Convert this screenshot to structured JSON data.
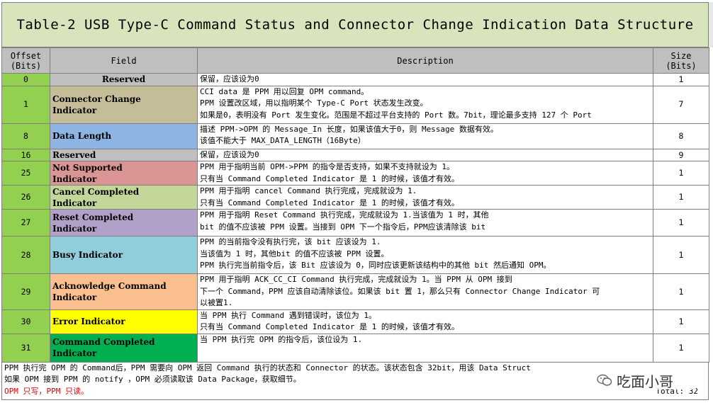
{
  "title": "Table-2 USB Type-C Command Status and Connector Change Indication Data Structure",
  "header": {
    "offset_line1": "Offset",
    "offset_line2": "(Bits)",
    "field": "Field",
    "description": "Description",
    "size_line1": "Size",
    "size_line2": "(Bits)"
  },
  "rows": [
    {
      "offset": "0",
      "field": [
        "Reserved"
      ],
      "desc": [
        "保留，应该设为0"
      ],
      "size": "1",
      "color": "#bfbfbf"
    },
    {
      "offset": "1",
      "field": [
        "Connector Change",
        "Indicator"
      ],
      "desc": [
        "CCI data 是 PPM 用以回复 OPM command。",
        "PPM 设置改区域，用以指明某个 Type-C Port 状态发生改变。",
        "如果是0，表明没有 Port 发生变化。范围是不超过平台支持的 Port 数。7bit，理论最多支持 127 个 Port"
      ],
      "size": "7",
      "color": "#c4bd97"
    },
    {
      "offset": "8",
      "field": [
        "Data Length"
      ],
      "desc": [
        "描述 PPM->OPM 的 Message_In 长度，如果该值大于0，则 Message 数据有效。",
        "该值不能大于 MAX_DATA_LENGTH（16Byte）"
      ],
      "size": "8",
      "color": "#8db4e2"
    },
    {
      "offset": "16",
      "field": [
        "Reserved"
      ],
      "desc": [
        "保留，应该设为0"
      ],
      "size": "9",
      "color": "#bfbfbf"
    },
    {
      "offset": "25",
      "field": [
        "Not Supported",
        "Indicator"
      ],
      "desc": [
        "PPM 用于指明当前 OPM->PPM 的指令是否支持，如果不支持就设为 1。",
        "只有当 Command Completed Indicator 是 1 的时候，该值才有效。"
      ],
      "size": "1",
      "color": "#da9694"
    },
    {
      "offset": "26",
      "field": [
        "Cancel Completed",
        "Indicator"
      ],
      "desc": [
        "PPM 用于指明 cancel Command 执行完成，完成就设为 1.",
        "只有当 Command Completed Indicator 是 1 的时候，该值才有效。"
      ],
      "size": "1",
      "color": "#c4d79b"
    },
    {
      "offset": "27",
      "field": [
        "Reset Completed",
        "Indicator"
      ],
      "desc": [
        "PPM 用于指明 Reset Command 执行完成，完成就设为 1.当该值为 1 时，其他",
        "bit 的值不应该被 PPM 设置。当接到 OPM 下一个指令后，PPM应该清除该 bit"
      ],
      "size": "1",
      "color": "#b1a0c7"
    },
    {
      "offset": "28",
      "field": [
        "Busy Indicator"
      ],
      "desc": [
        "PPM 的当前指令没有执行完，该 bit 应该设为 1.",
        "当该值为 1 时，其他bit 的值不应该被 PPM 设置。",
        "PPM 执行完当前指令后，该 Bit 应该设为 0，同时应该更新该结构中的其他 bit 然后通知 OPM。"
      ],
      "size": "1",
      "color": "#92cddc"
    },
    {
      "offset": "29",
      "field": [
        "Acknowledge Command",
        "Indicator"
      ],
      "desc": [
        "PPM 用于指明 ACK_CC_CI Command 执行完成，完成就设为 1。当 PPM 从 OPM 接到",
        "下一个 Command，PPM 应该自动清除该位。如果该 bit 置 1，那么只有 Connector Change Indicator 可",
        "以被置1."
      ],
      "size": "1",
      "color": "#fabf8f"
    },
    {
      "offset": "30",
      "field": [
        "Error Indicator"
      ],
      "desc": [
        "当 PPM 执行 Command 遇到错误时，该位为 1。",
        "只有当 Command Completed Indicator 是 1 的时候，该值才有效。"
      ],
      "size": "1",
      "color": "#ffff00"
    },
    {
      "offset": "31",
      "field": [
        "Command Completed",
        "Indicator"
      ],
      "desc": [
        "当 PPM 执行完 OPM 的指令后，该位设为 1."
      ],
      "size": "1",
      "color": "#00b050"
    }
  ],
  "footer": {
    "line1": "PPM 执行完 OPM 的 Command后，PPM 需要向 OPM 返回 Command 执行的状态和 Connector 的状态。该状态包含 32bit，用该 Data Struct",
    "line2": "如果 OPM 接到 PPM 的 notify ，OPM 必须读取该 Data Package，获取细节。",
    "line3": "OPM 只写，PPM 只读。",
    "total": "Total: 32"
  },
  "watermark": {
    "text": "吃面小哥",
    "fragment": "描述"
  },
  "colors": {
    "title_bg": "#d8e4bc",
    "header_bg": "#bfbfbf",
    "offset_bg": "#92d050",
    "border": "#7f7f7f",
    "footer_red": "#e00000"
  }
}
